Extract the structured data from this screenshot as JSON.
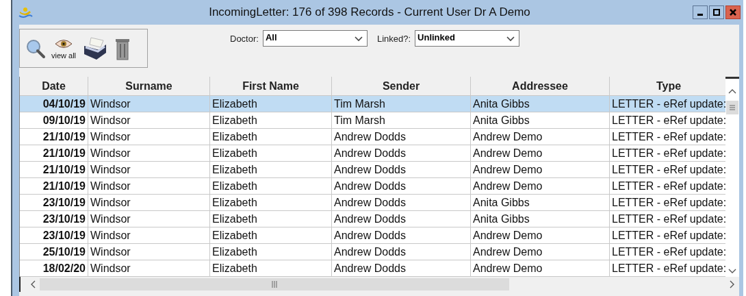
{
  "window": {
    "title": "IncomingLetter: 176 of 398 Records - Current User Dr A Demo"
  },
  "toolbar": {
    "view_all_label": "view all"
  },
  "filters": [
    {
      "label": "Doctor:",
      "value": "All"
    },
    {
      "label": "Linked?:",
      "value": "Unlinked"
    }
  ],
  "table": {
    "columns": [
      "Date",
      "Surname",
      "First Name",
      "Sender",
      "Addressee",
      "Type"
    ],
    "rows": [
      {
        "cells": [
          "04/10/19",
          "Windsor",
          "Elizabeth",
          "Tim Marsh",
          "Anita Gibbs",
          "LETTER - eRef update:"
        ],
        "selected": true
      },
      {
        "cells": [
          "09/10/19",
          "Windsor",
          "Elizabeth",
          "Tim Marsh",
          "Anita Gibbs",
          "LETTER - eRef update:"
        ],
        "selected": false
      },
      {
        "cells": [
          "21/10/19",
          "Windsor",
          "Elizabeth",
          "Andrew Dodds",
          "Andrew Demo",
          "LETTER - eRef update:"
        ],
        "selected": false
      },
      {
        "cells": [
          "21/10/19",
          "Windsor",
          "Elizabeth",
          "Andrew Dodds",
          "Andrew Demo",
          "LETTER - eRef update:"
        ],
        "selected": false
      },
      {
        "cells": [
          "21/10/19",
          "Windsor",
          "Elizabeth",
          "Andrew Dodds",
          "Andrew Demo",
          "LETTER - eRef update:"
        ],
        "selected": false
      },
      {
        "cells": [
          "21/10/19",
          "Windsor",
          "Elizabeth",
          "Andrew Dodds",
          "Andrew Demo",
          "LETTER - eRef update:"
        ],
        "selected": false
      },
      {
        "cells": [
          "23/10/19",
          "Windsor",
          "Elizabeth",
          "Andrew Dodds",
          "Anita Gibbs",
          "LETTER - eRef update:"
        ],
        "selected": false
      },
      {
        "cells": [
          "23/10/19",
          "Windsor",
          "Elizabeth",
          "Andrew Dodds",
          "Anita Gibbs",
          "LETTER - eRef update:"
        ],
        "selected": false
      },
      {
        "cells": [
          "23/10/19",
          "Windsor",
          "Elizabeth",
          "Andrew Dodds",
          "Andrew Demo",
          "LETTER - eRef update:"
        ],
        "selected": false
      },
      {
        "cells": [
          "25/10/19",
          "Windsor",
          "Elizabeth",
          "Andrew Dodds",
          "Andrew Demo",
          "LETTER - eRef update:"
        ],
        "selected": false
      },
      {
        "cells": [
          "18/02/20",
          "Windsor",
          "Elizabeth",
          "Andrew Dodds",
          "Andrew Demo",
          "LETTER - eRef update:"
        ],
        "selected": false
      }
    ]
  }
}
